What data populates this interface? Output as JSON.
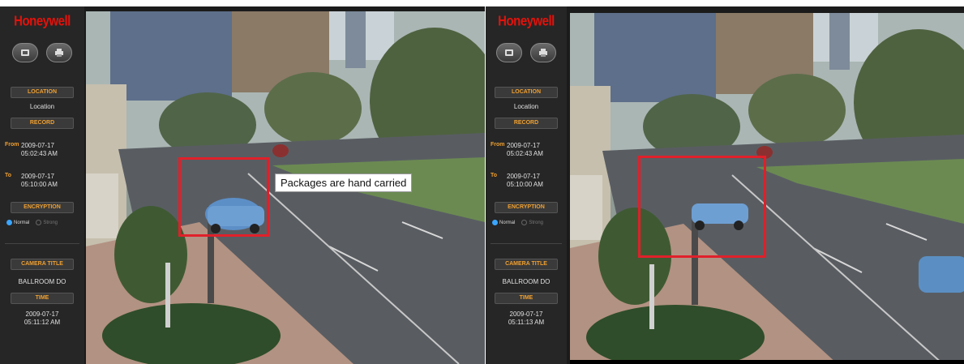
{
  "left": {
    "brand": "Honeywell",
    "location_header": "LOCATION",
    "location_value": "Location",
    "record_header": "RECORD",
    "from_label": "From",
    "from_datetime": [
      "2009-07-17",
      "05:02:43 AM"
    ],
    "to_label": "To",
    "to_datetime": [
      "2009-07-17",
      "05:10:00 AM"
    ],
    "encryption_header": "ENCRYPTION",
    "encryption_options": [
      "Normal",
      "Strong"
    ],
    "camera_title_header": "CAMERA TITLE",
    "camera_title_value": "BALLROOM DO",
    "time_header": "TIME",
    "time_value": [
      "2009-07-17",
      "05:11:12 AM"
    ],
    "annotation": "Packages are hand carried"
  },
  "right": {
    "brand": "Honeywell",
    "location_header": "LOCATION",
    "location_value": "Location",
    "record_header": "RECORD",
    "from_label": "From",
    "from_datetime": [
      "2009-07-17",
      "05:02:43 AM"
    ],
    "to_label": "To",
    "to_datetime": [
      "2009-07-17",
      "05:10:00 AM"
    ],
    "encryption_header": "ENCRYPTION",
    "encryption_options": [
      "Normal",
      "Strong"
    ],
    "camera_title_header": "CAMERA TITLE",
    "camera_title_value": "BALLROOM DO",
    "time_header": "TIME",
    "time_value": [
      "2009-07-17",
      "05:11:13 AM"
    ]
  },
  "colors": {
    "brand": "#e3120b",
    "accent": "#f0a030",
    "detection": "#e0202a",
    "radio": "#3aa6ff"
  },
  "icons": [
    "snapshot-icon",
    "print-icon"
  ]
}
